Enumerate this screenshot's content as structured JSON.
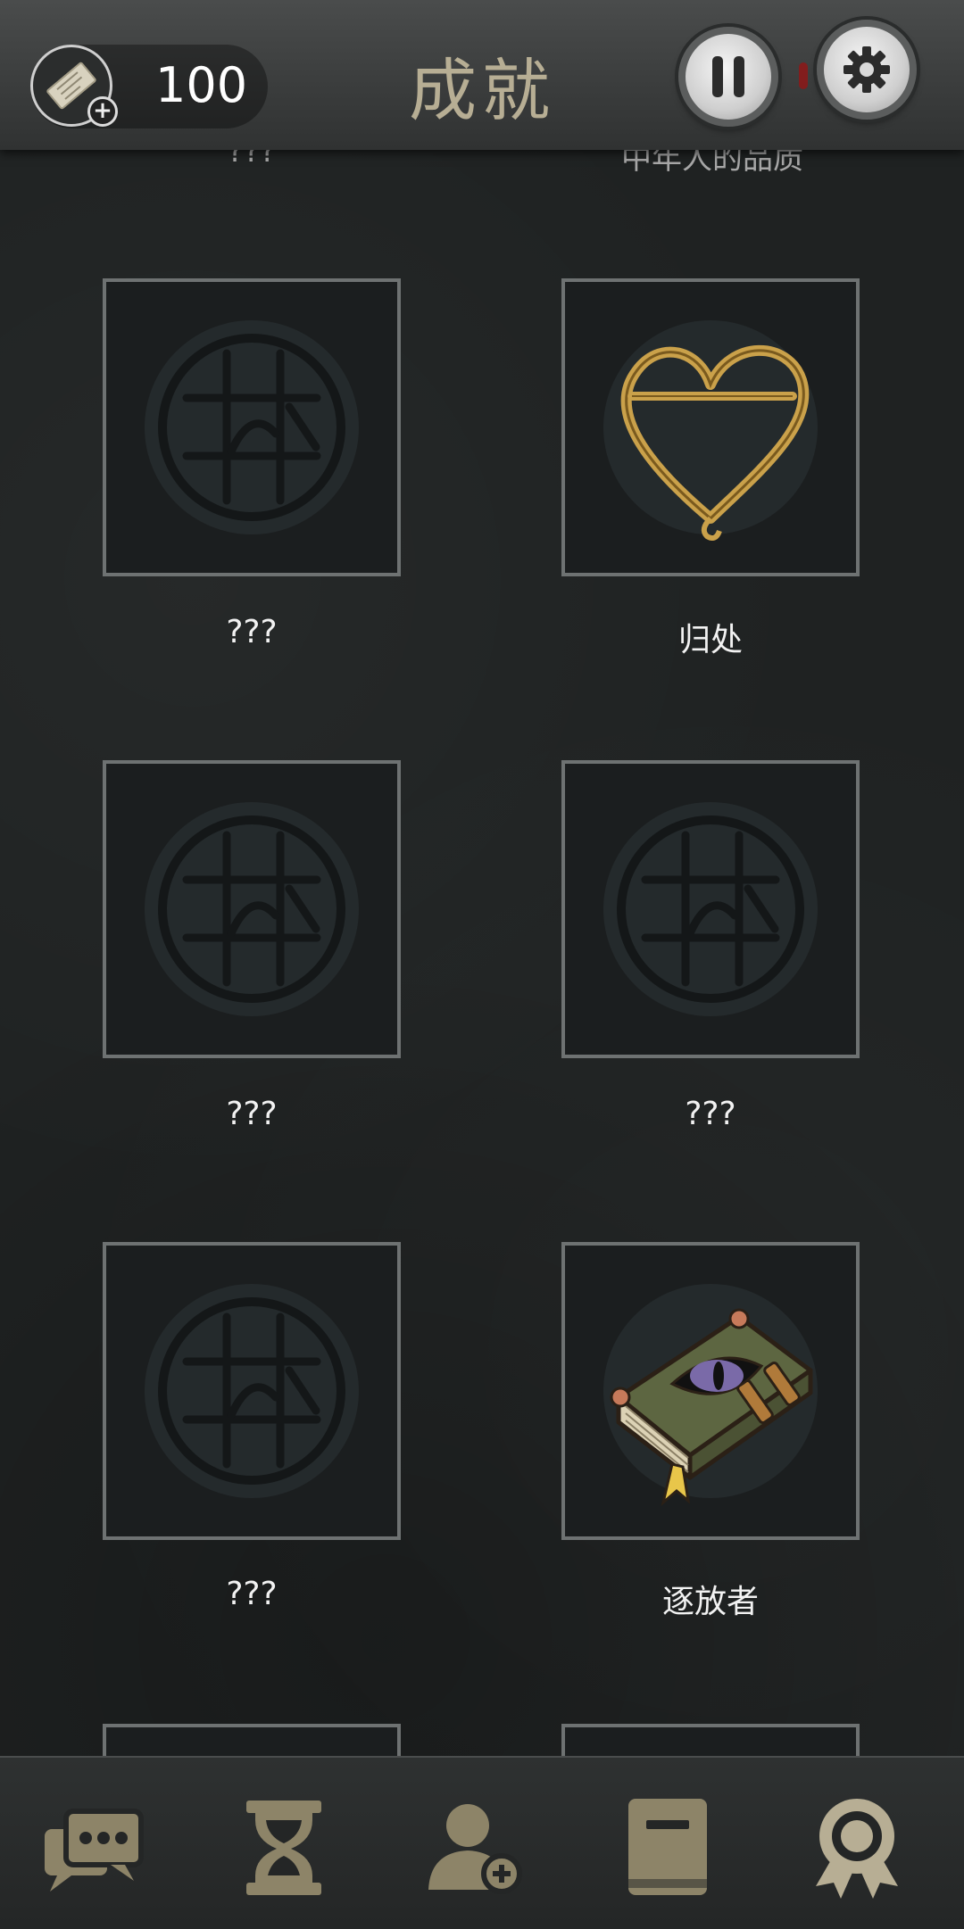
{
  "header": {
    "title": "成就",
    "currency_value": "100",
    "icons": [
      "ticket-icon",
      "add-icon",
      "pause-icon",
      "gear-icon"
    ]
  },
  "achievements": {
    "top_peek": [
      "???",
      "中年人的品质"
    ],
    "items": [
      {
        "label": "???",
        "icon": "locked-seal-icon",
        "unlocked": false
      },
      {
        "label": "归处",
        "icon": "golden-heart-icon",
        "unlocked": true
      },
      {
        "label": "???",
        "icon": "locked-seal-icon",
        "unlocked": false
      },
      {
        "label": "???",
        "icon": "locked-seal-icon",
        "unlocked": false
      },
      {
        "label": "???",
        "icon": "locked-seal-icon",
        "unlocked": false
      },
      {
        "label": "逐放者",
        "icon": "eye-book-icon",
        "unlocked": true
      }
    ]
  },
  "bottom_nav": {
    "items": [
      "chat-icon",
      "hourglass-icon",
      "add-contact-icon",
      "book-icon",
      "achievement-medal-icon"
    ],
    "active": "achievement-medal-icon"
  },
  "colors": {
    "background": "#1f2222",
    "title": "#b7ae94",
    "nav_icon": "#8d8468",
    "card_border": "#6e7272"
  }
}
